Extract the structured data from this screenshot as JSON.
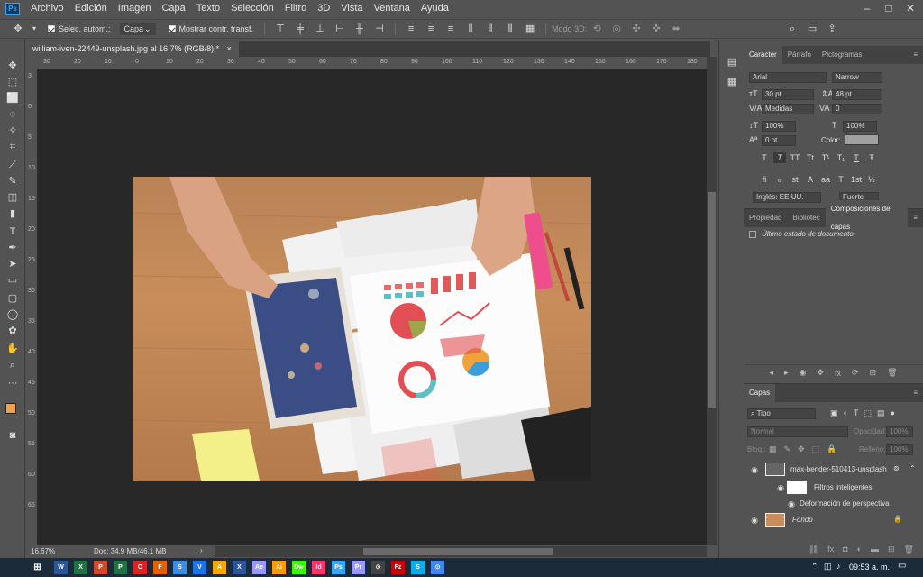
{
  "menubar": {
    "logo": "Ps",
    "items": [
      "Archivo",
      "Edición",
      "Imagen",
      "Capa",
      "Texto",
      "Selección",
      "Filtro",
      "3D",
      "Vista",
      "Ventana",
      "Ayuda"
    ],
    "minimize": "–",
    "maximize": "□",
    "close": "✕"
  },
  "options": {
    "auto_select_label": "Selec. autom.:",
    "auto_select_value": "Capa",
    "show_transform_label": "Mostrar contr. transf.",
    "mode3d_label": "Modo 3D:"
  },
  "document": {
    "tab_title": "william-iven-22449-unsplash.jpg al 16.7% (RGB/8) *",
    "close": "×",
    "ruler_h": [
      "30",
      "20",
      "10",
      "0",
      "10",
      "20",
      "30",
      "40",
      "50",
      "60",
      "70",
      "80",
      "90",
      "100",
      "110",
      "120",
      "130",
      "140",
      "150",
      "160",
      "170",
      "180"
    ],
    "ruler_v": [
      "3",
      "0",
      "5",
      "10",
      "15",
      "20",
      "25",
      "30",
      "35",
      "40",
      "45",
      "50",
      "55",
      "60",
      "65"
    ]
  },
  "status": {
    "zoom": "16.67%",
    "doc_info": "Doc: 34.9 MB/46.1 MB"
  },
  "character_panel": {
    "tabs": [
      "Carácter",
      "Párrafo",
      "Pictogramas"
    ],
    "font_family": "Arial",
    "font_style": "Narrow",
    "font_size": "30 pt",
    "leading": "48 pt",
    "kerning": "Medidas",
    "tracking": "0",
    "vscale": "100%",
    "hscale": "100%",
    "baseline": "0 pt",
    "color_label": "Color:",
    "language": "Inglés: EE.UU.",
    "antialias": "Fuerte",
    "style_buttons": [
      "T",
      "T",
      "TT",
      "Tt",
      "T¹",
      "T₁",
      "T",
      "Ŧ"
    ],
    "ot_buttons": [
      "fi",
      "ℴ",
      "st",
      "A",
      "aa",
      "T",
      "1st",
      "½"
    ]
  },
  "comps_panel": {
    "tabs": [
      "Propiedad",
      "Bibliotec",
      "Composiciones de capas"
    ],
    "item": "Último estado de documento"
  },
  "layers_panel": {
    "title": "Capas",
    "filter": "Tipo",
    "blend": "Normal",
    "opacity_label": "Opacidad:",
    "opacity": "100%",
    "lock_label": "Bloq.:",
    "fill_label": "Relleno:",
    "fill": "100%",
    "layers": [
      {
        "name": "max-bender-510413-unsplash"
      },
      {
        "name": "Filtros inteligentes"
      },
      {
        "name": "Deformación de perspectiva"
      },
      {
        "name": "Fondo"
      }
    ]
  },
  "taskbar": {
    "apps": [
      "W",
      "X",
      "P",
      "P",
      "O",
      "F",
      "S",
      "V",
      "A",
      "X",
      "Ae",
      "Ai",
      "Dw",
      "Id",
      "Ps",
      "Pr",
      "⊙",
      "Fz",
      "S",
      "⊙"
    ],
    "time": "09:53 a. m."
  },
  "colors": {
    "foreground": "#f0a24f",
    "background": "#ffffff",
    "text_color": "#a0a0a0"
  }
}
